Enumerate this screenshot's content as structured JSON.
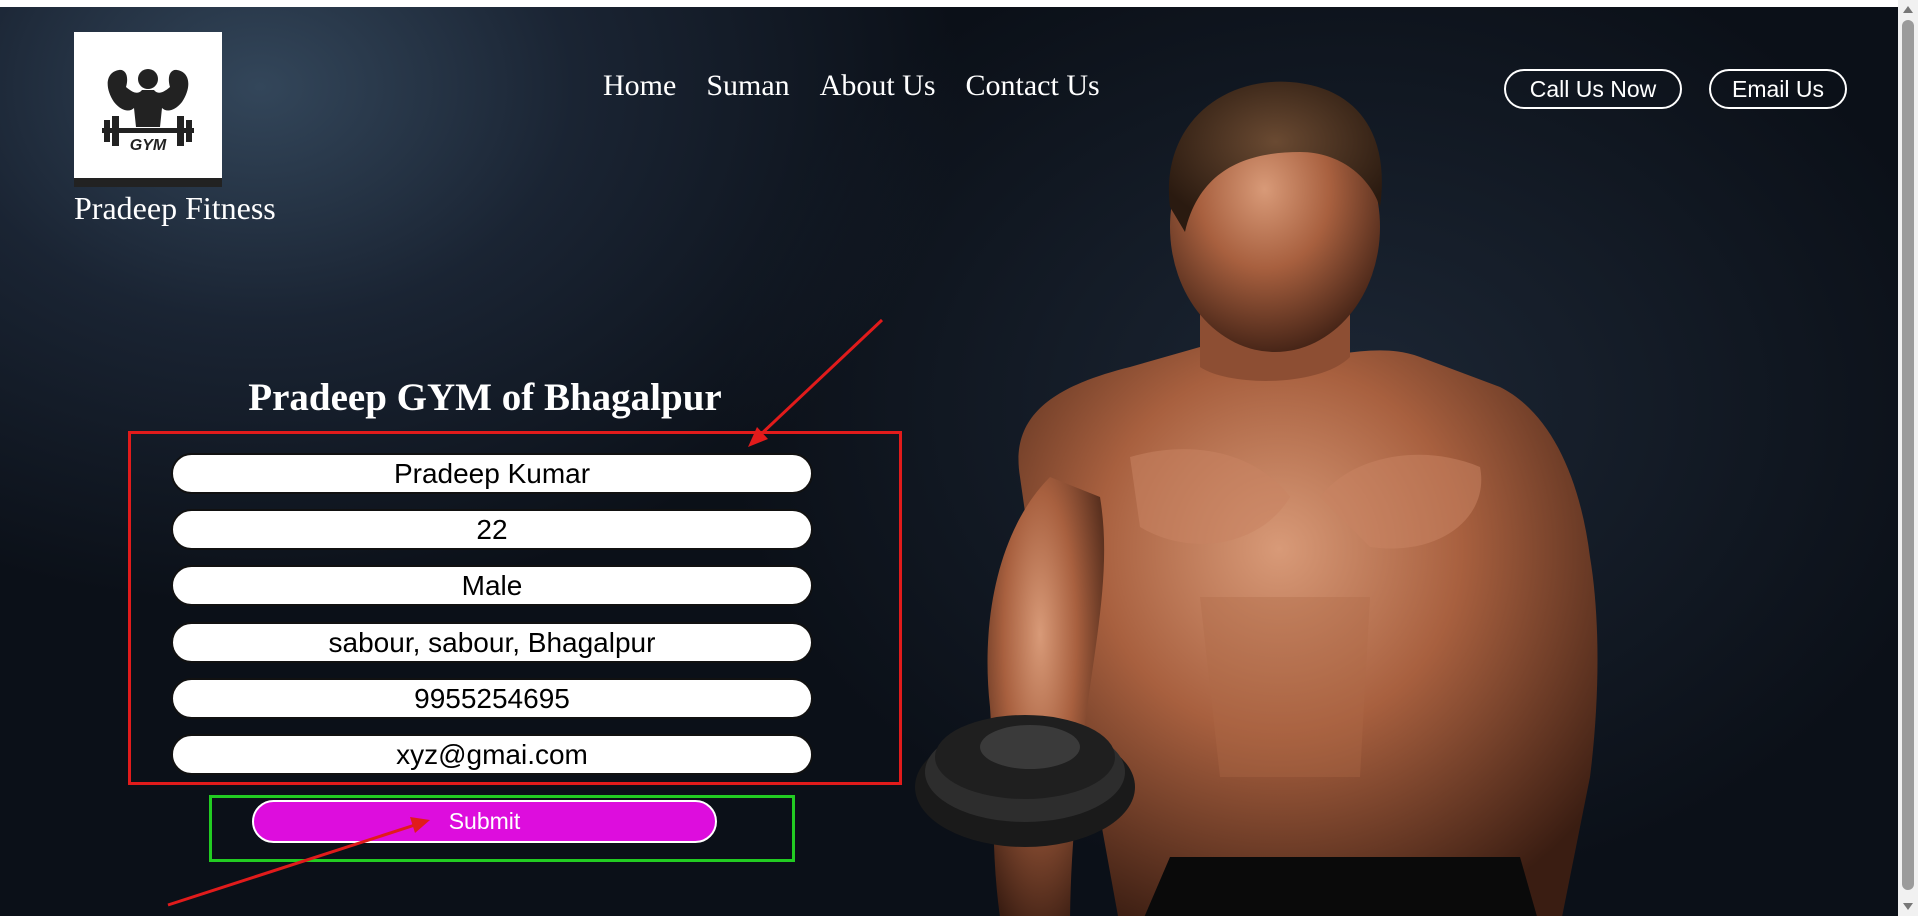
{
  "brand": {
    "logo_text": "GYM",
    "name": "Pradeep Fitness"
  },
  "nav": {
    "items": [
      "Home",
      "Suman",
      "About Us",
      "Contact Us"
    ]
  },
  "actions": {
    "call_label": "Call Us Now",
    "email_label": "Email Us"
  },
  "form": {
    "title": "Pradeep GYM of Bhagalpur",
    "fields": [
      {
        "name": "name",
        "value": "Pradeep Kumar"
      },
      {
        "name": "age",
        "value": "22"
      },
      {
        "name": "gender",
        "value": "Male"
      },
      {
        "name": "address",
        "value": "sabour, sabour, Bhagalpur"
      },
      {
        "name": "phone",
        "value": "9955254695"
      },
      {
        "name": "email",
        "value": "xyz@gmai.com"
      }
    ],
    "submit_label": "Submit"
  },
  "colors": {
    "submit_bg": "#dd0ddd",
    "annotation_red": "#e11b1b",
    "annotation_green": "#22cc22"
  }
}
